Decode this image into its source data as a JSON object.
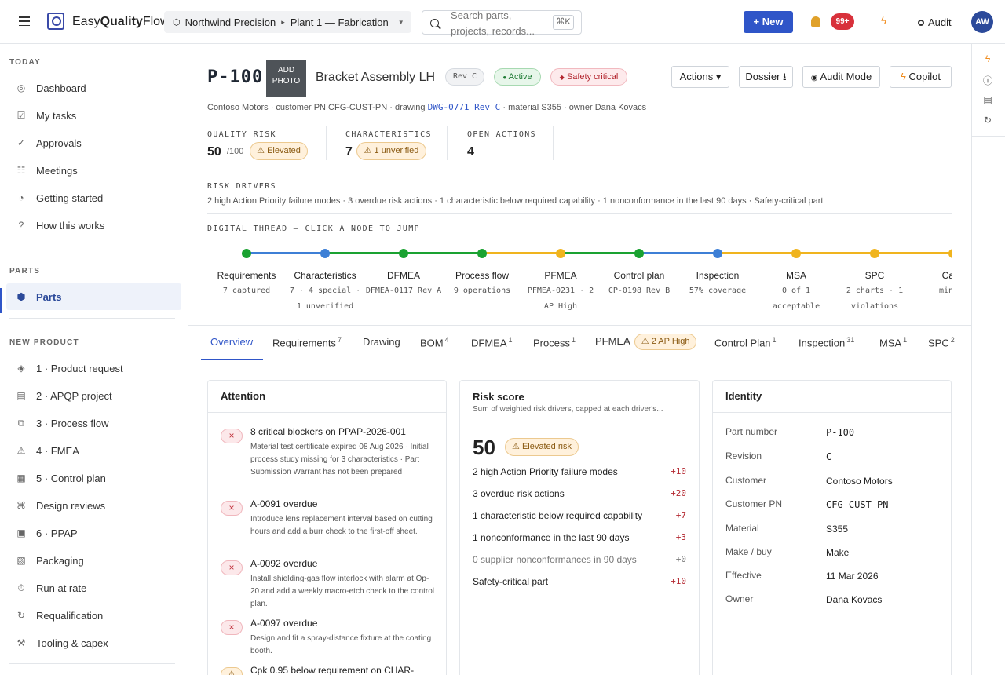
{
  "topbar": {
    "brand_prefix": "Easy",
    "brand_bold": "Quality",
    "brand_suffix": "Flow",
    "org": "Northwind Precision",
    "site": "Plant 1 — Fabrication",
    "search_placeholder": "Search parts, projects, records...",
    "shortcut": "⌘K",
    "new_label": "+  New",
    "notifications": "99+",
    "audit_label": "Audit",
    "avatar": "AW"
  },
  "sidebar": {
    "today_label": "TODAY",
    "today": [
      "Dashboard",
      "My tasks",
      "Approvals",
      "Meetings",
      "Getting started",
      "How this works"
    ],
    "parts_label": "PARTS",
    "parts": [
      "Parts"
    ],
    "new_product_label": "NEW PRODUCT",
    "new_product": [
      "1 · Product request",
      "2 · APQP project",
      "3 · Process flow",
      "4 · FMEA",
      "5 · Control plan",
      "Design reviews",
      "6 · PPAP",
      "Packaging",
      "Run at rate",
      "Requalification",
      "Tooling & capex"
    ]
  },
  "header": {
    "part_number": "P-100",
    "photo_label": "ADD PHOTO",
    "title": "Bracket Assembly LH",
    "rev": "Rev C",
    "status": "Active",
    "safety": "Safety critical",
    "actions": [
      "Actions ▾",
      "Dossier ⭳",
      "Audit Mode",
      "Copilot"
    ],
    "meta_prefix": "Contoso Motors · customer PN CFG-CUST-PN · drawing ",
    "drawing_link": "DWG-0771 Rev C",
    "meta_suffix": " · material S355 · owner Dana Kovacs"
  },
  "kpis": {
    "risk_label": "QUALITY RISK",
    "risk_value": "50",
    "risk_of": "/100",
    "risk_badge": "Elevated",
    "char_label": "CHARACTERISTICS",
    "char_value": "7",
    "char_badge": "1 unverified",
    "actions_label": "OPEN ACTIONS",
    "actions_value": "4"
  },
  "risk_drivers": {
    "label": "RISK DRIVERS",
    "text": "2 high Action Priority failure modes · 3 overdue risk actions · 1 characteristic below required capability · 1 nonconformance in the last 90 days · Safety-critical part"
  },
  "thread": {
    "label": "DIGITAL THREAD — CLICK A NODE TO JUMP",
    "nodes": [
      {
        "name": "Requirements",
        "sub1": "7 captured",
        "sub2": "",
        "status": "#1aa231"
      },
      {
        "name": "Characteristics",
        "sub1": "7 · 4 special ·",
        "sub2": "1 unverified",
        "status": "#3d7fd6"
      },
      {
        "name": "DFMEA",
        "sub1": "DFMEA-0117 Rev A",
        "sub2": "",
        "status": "#1aa231"
      },
      {
        "name": "Process flow",
        "sub1": "9 operations",
        "sub2": "",
        "status": "#1aa231"
      },
      {
        "name": "PFMEA",
        "sub1": "PFMEA-0231 · 2",
        "sub2": "AP High",
        "status": "#f0b41e"
      },
      {
        "name": "Control plan",
        "sub1": "CP-0198 Rev B",
        "sub2": "",
        "status": "#1aa231"
      },
      {
        "name": "Inspection",
        "sub1": "57% coverage",
        "sub2": "",
        "status": "#3d7fd6"
      },
      {
        "name": "MSA",
        "sub1": "0 of 1",
        "sub2": "acceptable",
        "status": "#f0b41e"
      },
      {
        "name": "SPC",
        "sub1": "2 charts · 1",
        "sub2": "violations",
        "status": "#f0b41e"
      },
      {
        "name": "Capa",
        "sub1": "min Cp",
        "sub2": "",
        "status": "#f0b41e"
      }
    ]
  },
  "tabs": [
    {
      "label": "Overview",
      "count": ""
    },
    {
      "label": "Requirements",
      "count": "7"
    },
    {
      "label": "Drawing",
      "count": ""
    },
    {
      "label": "BOM",
      "count": "4"
    },
    {
      "label": "DFMEA",
      "count": "1"
    },
    {
      "label": "Process",
      "count": "1"
    },
    {
      "label": "PFMEA",
      "count": "",
      "badge": "2 AP High"
    },
    {
      "label": "Control Plan",
      "count": "1"
    },
    {
      "label": "Inspection",
      "count": "31"
    },
    {
      "label": "MSA",
      "count": "1"
    },
    {
      "label": "SPC",
      "count": "2"
    }
  ],
  "attention": {
    "title": "Attention",
    "items": [
      {
        "title": "8 critical blockers on PPAP-2026-001",
        "desc": "Material test certificate expired 08 Aug 2026 · Initial process study missing for 3 characteristics · Part Submission Warrant has not been prepared",
        "icon": "×"
      },
      {
        "title": "A-0091 overdue",
        "desc": "Introduce lens replacement interval based on cutting hours and add a burr check to the first-off sheet.",
        "icon": "×"
      },
      {
        "title": "A-0092 overdue",
        "desc": "Install shielding-gas flow interlock with alarm at Op-20 and add a weekly macro-etch check to the control plan.",
        "icon": "×"
      },
      {
        "title": "A-0097 overdue",
        "desc": "Design and fit a spray-distance fixture at the coating booth.",
        "icon": "×"
      },
      {
        "title": "Cpk 0.95 below requirement on CHAR-",
        "desc": "",
        "icon": "⚠"
      }
    ]
  },
  "risk_card": {
    "title": "Risk score",
    "subtitle": "Sum of weighted risk drivers, capped at each driver's...",
    "score": "50",
    "badge": "Elevated risk",
    "rows": [
      {
        "label": "2 high Action Priority failure modes",
        "points": "+10"
      },
      {
        "label": "3 overdue risk actions",
        "points": "+20"
      },
      {
        "label": "1 characteristic below required capability",
        "points": "+7"
      },
      {
        "label": "1 nonconformance in the last 90 days",
        "points": "+3"
      },
      {
        "label": "0 supplier nonconformances in 90 days",
        "points": "+0"
      },
      {
        "label": "Safety-critical part",
        "points": "+10"
      }
    ]
  },
  "identity": {
    "title": "Identity",
    "rows": [
      {
        "k": "Part number",
        "v": "P-100"
      },
      {
        "k": "Revision",
        "v": "C"
      },
      {
        "k": "Customer",
        "v": "Contoso Motors"
      },
      {
        "k": "Customer PN",
        "v": "CFG-CUST-PN"
      },
      {
        "k": "Material",
        "v": "S355"
      },
      {
        "k": "Make / buy",
        "v": "Make"
      },
      {
        "k": "Effective",
        "v": "11 Mar 2026"
      },
      {
        "k": "Owner",
        "v": "Dana Kovacs"
      }
    ]
  },
  "colors": {
    "accent": "#2f55c8",
    "done": "#1aa231",
    "info": "#3d7fd6",
    "warn": "#f0b41e",
    "danger": "#d8313b"
  }
}
